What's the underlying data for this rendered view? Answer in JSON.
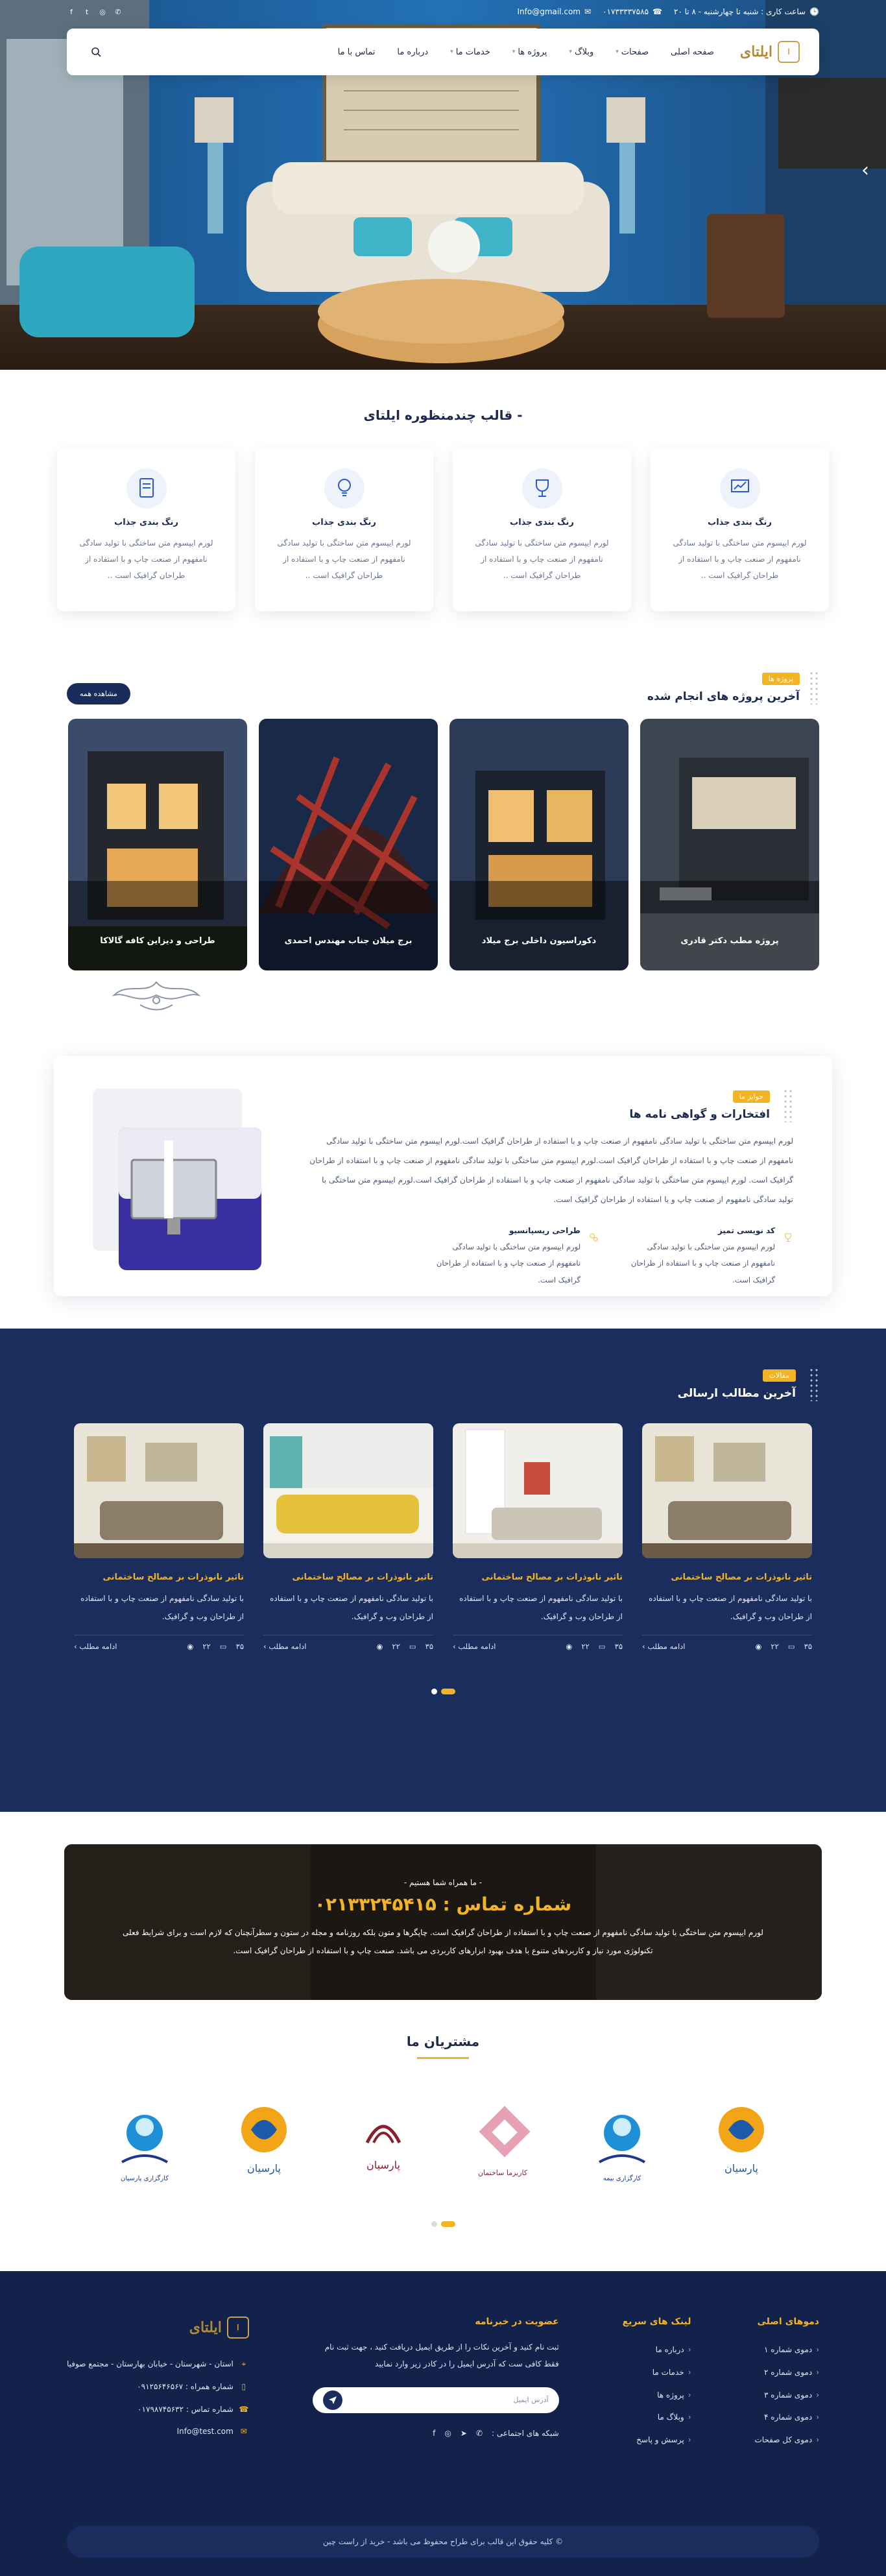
{
  "topbar": {
    "hours": "ساعت کاری : شنبه تا چهارشنبه - ۸ تا ۲۰",
    "phone": "۰۱۷۳۳۳۳۷۵۸۵",
    "email": "Info@gmail.com"
  },
  "brand": {
    "name": "ایلتای",
    "mark": "ا"
  },
  "nav": {
    "items": [
      {
        "label": "صفحه اصلی",
        "caret": false
      },
      {
        "label": "صفحات",
        "caret": true
      },
      {
        "label": "وبلاگ",
        "caret": true
      },
      {
        "label": "پروژه ها",
        "caret": true
      },
      {
        "label": "خدمات ما",
        "caret": true
      },
      {
        "label": "درباره ما",
        "caret": false
      },
      {
        "label": "تماس با ما",
        "caret": false
      }
    ]
  },
  "features": {
    "title": "- قالب چندمنظوره ایلتای",
    "items": [
      {
        "title": "رنگ بندی جذاب",
        "text": "لورم ایپسوم متن ساختگی با تولید سادگی نامفهوم از صنعت چاپ و با استفاده از طراحان گرافیک است ..",
        "icon": "presentation-icon"
      },
      {
        "title": "رنگ بندی جذاب",
        "text": "لورم ایپسوم متن ساختگی با تولید سادگی نامفهوم از صنعت چاپ و با استفاده از طراحان گرافیک است ..",
        "icon": "trophy-icon"
      },
      {
        "title": "رنگ بندی جذاب",
        "text": "لورم ایپسوم متن ساختگی با تولید سادگی نامفهوم از صنعت چاپ و با استفاده از طراحان گرافیک است ..",
        "icon": "idea-icon"
      },
      {
        "title": "رنگ بندی جذاب",
        "text": "لورم ایپسوم متن ساختگی با تولید سادگی نامفهوم از صنعت چاپ و با استفاده از طراحان گرافیک است ..",
        "icon": "document-icon"
      }
    ]
  },
  "projects": {
    "tag": "پروژه ها",
    "title": "آخرین پروژه های انجام شده",
    "button": "مشاهده همه",
    "items": [
      {
        "caption": "پروژه مطب دکتر قادری"
      },
      {
        "caption": "دکوراسیون داخلی برج میلاد"
      },
      {
        "caption": "برج میلان جناب مهندس احمدی"
      },
      {
        "caption": "طراحی و دیزاین کافه گالاکا"
      }
    ]
  },
  "awards": {
    "tag": "جوایز ما",
    "title": "افتخارات و گواهی نامه ها",
    "intro": "لورم ایپسوم متن ساختگی با تولید سادگی نامفهوم از صنعت چاپ و با استفاده از طراحان گرافیک است.لورم ایپسوم متن ساختگی با تولید سادگی نامفهوم از صنعت چاپ و با استفاده از طراحان گرافیک است.لورم ایپسوم متن ساختگی با تولید سادگی نامفهوم از صنعت چاپ و با استفاده از طراحان گرافیک است. لورم ایپسوم متن ساختگی با تولید سادگی نامفهوم از صنعت چاپ و با استفاده از طراحان گرافیک است.لورم ایپسوم متن ساختگی با تولید سادگی نامفهوم از صنعت چاپ و با استفاده از طراحان گرافیک است.",
    "items": [
      {
        "title": "کد نویسی تمیز",
        "text": "لورم ایپسوم متن ساختگی با تولید سادگی نامفهوم از صنعت چاپ و با استفاده از طراحان گرافیک است.",
        "icon": "trophy-icon"
      },
      {
        "title": "طراحی ریسپانسیو",
        "text": "لورم ایپسوم متن ساختگی با تولید سادگی نامفهوم از صنعت چاپ و با استفاده از طراحان گرافیک است.",
        "icon": "gears-icon"
      }
    ]
  },
  "blog": {
    "tag": "مقالات",
    "title": "آخرین مطالب ارسالی",
    "posts": [
      {
        "title": "تاثیر نانوذرات بر مصالح ساختمانی",
        "text": "با تولید سادگی نامفهوم از صنعت چاپ و با استفاده از طراحان وب و گرافیک.",
        "more": "ادامه مطلب",
        "views": "۲۲",
        "comments": "۳۵"
      },
      {
        "title": "تاثیر نانوذرات بر مصالح ساختمانی",
        "text": "با تولید سادگی نامفهوم از صنعت چاپ و با استفاده از طراحان وب و گرافیک.",
        "more": "ادامه مطلب",
        "views": "۲۲",
        "comments": "۳۵"
      },
      {
        "title": "تاثیر نانوذرات بر مصالح ساختمانی",
        "text": "با تولید سادگی نامفهوم از صنعت چاپ و با استفاده از طراحان وب و گرافیک.",
        "more": "ادامه مطلب",
        "views": "۲۲",
        "comments": "۳۵"
      },
      {
        "title": "تاثیر نانوذرات بر مصالح ساختمانی",
        "text": "با تولید سادگی نامفهوم از صنعت چاپ و با استفاده از طراحان وب و گرافیک.",
        "more": "ادامه مطلب",
        "views": "۲۲",
        "comments": "۳۵"
      }
    ]
  },
  "cta": {
    "sub": "- ما همراه شما هستیم -",
    "phone": "شماره تماس : ۰۲۱۳۳۲۴۵۴۱۵",
    "body": "لورم ایپسوم متن ساختگی با تولید سادگی نامفهوم از صنعت چاپ و با استفاده از طراحان گرافیک است. چاپگرها و متون بلکه روزنامه و مجله در ستون و سطرآنچنان که لازم است و برای شرایط فعلی تکنولوژی مورد نیاز و کاربردهای متنوع با هدف بهبود ابزارهای کاربردی می باشد. صنعت چاپ و با استفاده از طراحان گرافیک است."
  },
  "clients": {
    "title": "مشتریان ما",
    "logos": [
      {
        "name": "پارسیان",
        "label": "پارسیان"
      },
      {
        "name": "kooshk",
        "label": "کاریزما ساختمان"
      },
      {
        "name": "parsian",
        "label": "پارسیان"
      },
      {
        "name": "kargozari",
        "label": "کارگزاری پارسیان"
      },
      {
        "name": "parsian-blue",
        "label": "پارسیان"
      },
      {
        "name": "insurance",
        "label": "کارگزاری بیمه"
      }
    ]
  },
  "footer": {
    "col_main": {
      "title": "دموهای اصلی",
      "items": [
        "دموی شماره ۱",
        "دموی شماره ۲",
        "دموی شماره ۳",
        "دموی شماره ۴",
        "دموی کل صفحات"
      ]
    },
    "col_links": {
      "title": "لینک های سریع",
      "items": [
        "درباره ما",
        "خدمات ما",
        "پروژه ها",
        "وبلاگ ما",
        "پرسش و پاسخ"
      ]
    },
    "news": {
      "title": "عضویت در خبرنامه",
      "text": "ثبت نام کنید و آخرین نکات را از طریق ایمیل دریافت کنید ، جهت ثبت نام فقط کافی ست که آدرس ایمیل را در کادر زیر وارد نمایید",
      "placeholder": "آدرس ایمیل",
      "social_label": "شبکه های اجتماعی :"
    },
    "contact": {
      "address": "استان - شهرستان - خیابان بهارستان - مجتمع صوفیا",
      "mobile": "شماره همراه : ۰۹۱۲۵۶۴۶۵۶۷",
      "phone": "شماره تماس : ۰۱۷۹۸۷۴۵۶۳۲",
      "email": "Info@test.com"
    },
    "copyright": "© کلیه حقوق این قالب برای طراح محفوظ می باشد - خرید از راست چین"
  },
  "colors": {
    "navy": "#1b2d5c",
    "accent": "#f2b324",
    "footer": "#13224a"
  }
}
